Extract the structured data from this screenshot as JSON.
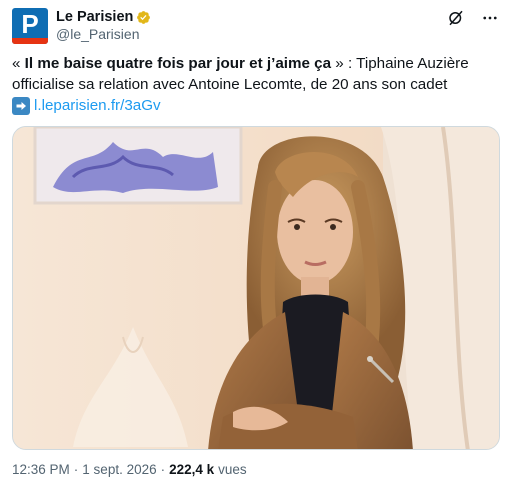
{
  "author": {
    "display_name": "Le Parisien",
    "handle": "@le_Parisien",
    "avatar_letter": "P",
    "avatar_color": "#0f6db3",
    "verified_badge": "gold-verified-icon"
  },
  "actions": {
    "grok_icon": "grok-icon",
    "more_icon": "more-icon"
  },
  "tweet": {
    "quote_open": "« ",
    "quote_bold": "Il me baise quatre fois par jour et j’aime ça",
    "quote_close": " » ",
    "rest_text": ": Tiphaine Auzière officialise sa relation avec Antoine Lecomte, de 20 ans son cadet",
    "link_icon": "right-arrow-icon",
    "link_text": "l.leparisien.fr/3aGv"
  },
  "media": {
    "type": "photo",
    "description_icon": "photo-image"
  },
  "meta": {
    "time": "12:36 PM",
    "separator1": "·",
    "date": "1 sept. 2026",
    "separator2": "·",
    "views_count": "222,4 k",
    "views_label": "vues"
  },
  "colors": {
    "link": "#1d9bf0",
    "secondary_text": "#536471",
    "verified_gold": "#e2b719"
  }
}
